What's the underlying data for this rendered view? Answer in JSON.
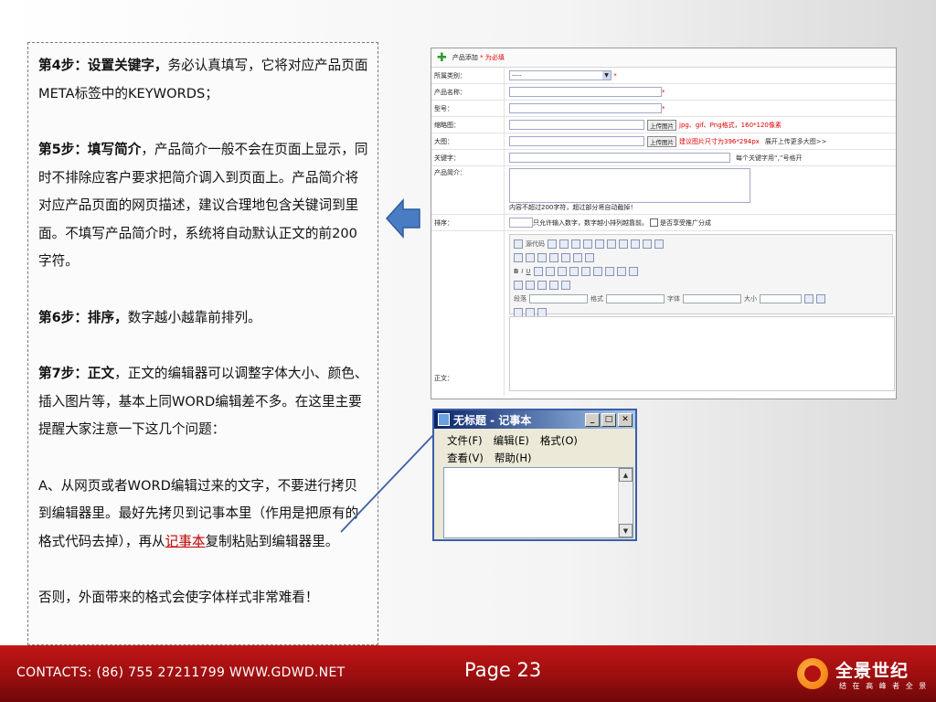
{
  "steps": {
    "step4_title": "第4步：设置关键字，",
    "step4_body": "务必认真填写，它将对应产品页面META标签中的KEYWORDS；",
    "step5_title": "第5步：填写简介",
    "step5_body": "，产品简介一般不会在页面上显示，同时不排除应客户要求把简介调入到页面上。产品简介将对应产品页面的网页描述，建议合理地包含关键词到里面。不填写产品简介时，系统将自动默认正文的前200字符。",
    "step6_title": "第6步：排序，",
    "step6_body": "数字越小越靠前排列。",
    "step7_title": "第7步：正文",
    "step7_body": "，正文的编辑器可以调整字体大小、颜色、插入图片等，基本上同WORD编辑差不多。在这里主要提醒大家注意一下这几个问题：",
    "pointA_pre": "A、从网页或者WORD编辑过来的文字，不要进行拷贝到编辑器里。最好先拷贝到记事本里（作用是把原有的格式代码去掉），再从",
    "pointA_link": "记事本",
    "pointA_post": "复制粘贴到编辑器里。",
    "warning": "否则，外面带来的格式会使字体样式非常难看！"
  },
  "form": {
    "header": "产品添加",
    "header_required": "* 为必填",
    "fields": {
      "category_label": "所属类别：",
      "category_value": "-----",
      "name_label": "产品名称：",
      "model_label": "型号：",
      "thumb_label": "缩略图：",
      "upload_btn": "上传图片",
      "thumb_hint": "jpg、gif、Png格式，160*120像素",
      "bigimg_label": "大图：",
      "bigimg_hint": "建议图片尺寸为396*294px",
      "bigimg_note": "展开上传更多大图>>",
      "keywords_label": "关键字：",
      "keywords_note": "每个关键字用“,”号格开",
      "intro_label": "产品简介：",
      "intro_note": "内容不超过200字符，超过部分将自动截掉！",
      "sort_label": "排序：",
      "sort_note": "只允许输入数字，数字越小排列越靠前。",
      "share_label": "是否享受推广分成",
      "body_label": "正文：",
      "tb_source": "源代码",
      "tb_para": "段落",
      "tb_format": "格式",
      "tb_font": "字体",
      "tb_size": "大小"
    }
  },
  "notepad": {
    "title": "无标题 - 记事本",
    "menu_file": "文件(F)",
    "menu_edit": "编辑(E)",
    "menu_format": "格式(O)",
    "menu_view": "查看(V)",
    "menu_help": "帮助(H)"
  },
  "footer": {
    "contacts": "CONTACTS: (86) 755 27211799 WWW.GDWD.NET",
    "page": "Page 23",
    "logo_name": "全景世纪",
    "logo_slogan": "结 在 高 峰 者 全 景"
  },
  "colors": {
    "footer_red": "#b01213",
    "link_red": "#c00000",
    "arrow_blue": "#4a7cc4"
  }
}
